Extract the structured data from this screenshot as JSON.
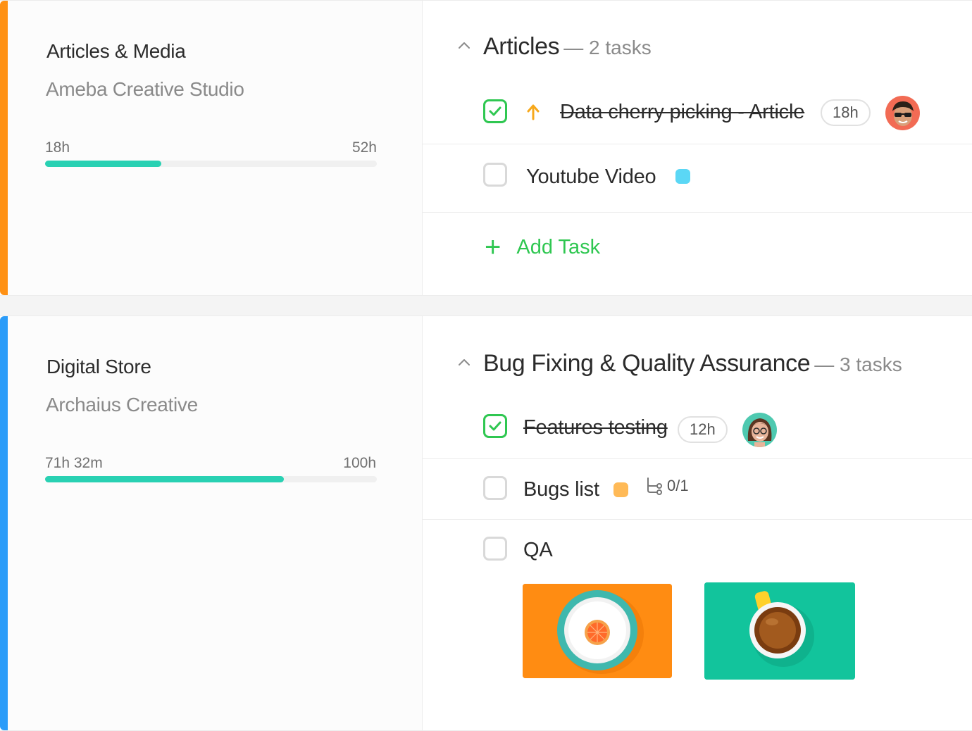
{
  "projects": [
    {
      "title": "Articles & Media",
      "client": "Ameba Creative Studio",
      "time_spent": "18h",
      "time_total": "52h",
      "progress": 0.35,
      "accent_color": "#ff9114",
      "group": {
        "name": "Articles",
        "count": "— 2 tasks",
        "tasks": [
          {
            "name": "Data cherry picking - Article",
            "done": true,
            "priority": "up-arrow-icon",
            "estimate": "18h",
            "assignee": "avatar-man-sunglasses"
          },
          {
            "name": "Youtube Video",
            "done": false,
            "tag_color": "#5bd7f5"
          }
        ],
        "add_label": "Add Task"
      }
    },
    {
      "title": "Digital Store",
      "client": "Archaius Creative",
      "time_spent": "71h 32m",
      "time_total": "100h",
      "progress": 0.72,
      "accent_color": "#2b9cf9",
      "group": {
        "name": "Bug Fixing & Quality Assurance",
        "count": "— 3 tasks",
        "tasks": [
          {
            "name": "Features testing",
            "done": true,
            "estimate": "12h",
            "assignee": "avatar-woman-glasses"
          },
          {
            "name": "Bugs list",
            "done": false,
            "tag_color": "#ffba57",
            "subtasks": "0/1"
          },
          {
            "name": "QA",
            "done": false,
            "attachments": [
              "orange-plate-image",
              "tea-cup-image"
            ]
          }
        ]
      }
    }
  ],
  "colors": {
    "progress": "#29d1b3",
    "check": "#2fc751",
    "priority": "#f7a81b"
  }
}
